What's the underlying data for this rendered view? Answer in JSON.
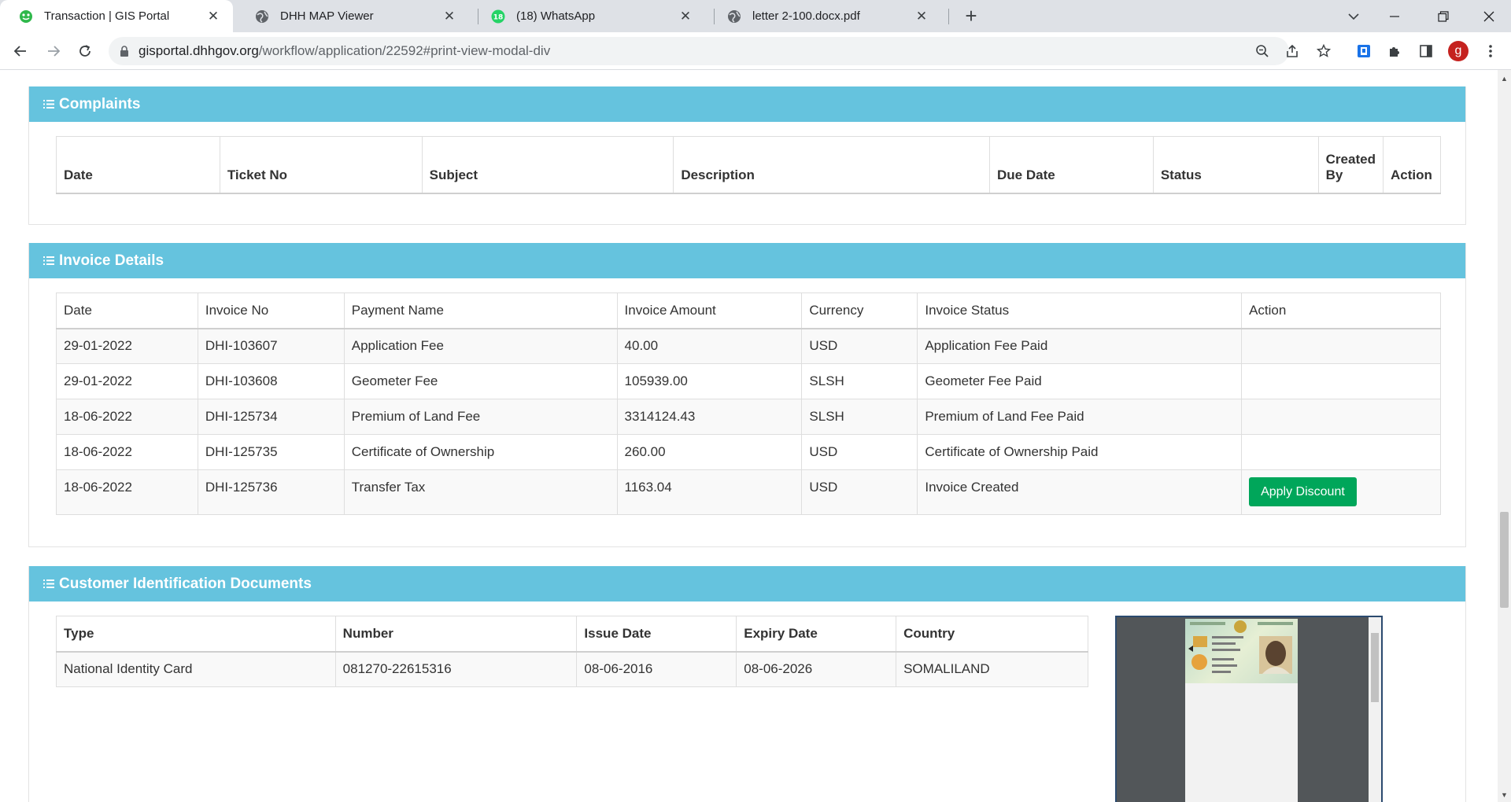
{
  "browser": {
    "tabs": [
      {
        "title": "Transaction | GIS Portal",
        "active": true,
        "favicon": "gis-portal-icon"
      },
      {
        "title": "DHH MAP Viewer",
        "active": false,
        "favicon": "globe-icon"
      },
      {
        "title": "(18) WhatsApp",
        "active": false,
        "favicon": "whatsapp-icon",
        "badge": "18"
      },
      {
        "title": "letter 2-100.docx.pdf",
        "active": false,
        "favicon": "globe-icon"
      }
    ],
    "url_host": "gisportal.dhhgov.org",
    "url_path": "/workflow/application/22592#print-view-modal-div",
    "profile_initial": "g"
  },
  "complaints": {
    "title": "Complaints",
    "columns": [
      "Date",
      "Ticket No",
      "Subject",
      "Description",
      "Due Date",
      "Status",
      "Created By",
      "Action"
    ]
  },
  "invoices": {
    "title": "Invoice Details",
    "columns": [
      "Date",
      "Invoice No",
      "Payment Name",
      "Invoice Amount",
      "Currency",
      "Invoice Status",
      "Action"
    ],
    "rows": [
      {
        "date": "29-01-2022",
        "invoice_no": "DHI-103607",
        "payment_name": "Application Fee",
        "amount": "40.00",
        "currency": "USD",
        "status": "Application Fee Paid",
        "action": ""
      },
      {
        "date": "29-01-2022",
        "invoice_no": "DHI-103608",
        "payment_name": "Geometer Fee",
        "amount": "105939.00",
        "currency": "SLSH",
        "status": "Geometer Fee Paid",
        "action": ""
      },
      {
        "date": "18-06-2022",
        "invoice_no": "DHI-125734",
        "payment_name": "Premium of Land Fee",
        "amount": "3314124.43",
        "currency": "SLSH",
        "status": "Premium of Land Fee Paid",
        "action": ""
      },
      {
        "date": "18-06-2022",
        "invoice_no": "DHI-125735",
        "payment_name": "Certificate of Ownership",
        "amount": "260.00",
        "currency": "USD",
        "status": "Certificate of Ownership Paid",
        "action": ""
      },
      {
        "date": "18-06-2022",
        "invoice_no": "DHI-125736",
        "payment_name": "Transfer Tax",
        "amount": "1163.04",
        "currency": "USD",
        "status": "Invoice Created",
        "action": "Apply Discount"
      }
    ]
  },
  "identification": {
    "title": "Customer Identification Documents",
    "columns": [
      "Type",
      "Number",
      "Issue Date",
      "Expiry Date",
      "Country"
    ],
    "rows": [
      {
        "type": "National Identity Card",
        "number": "081270-22615316",
        "issue_date": "08-06-2016",
        "expiry_date": "08-06-2026",
        "country": "SOMALILAND"
      }
    ]
  },
  "colors": {
    "panel_header": "#65c3de",
    "button_success": "#00a65a",
    "profile": "#c5221f"
  }
}
